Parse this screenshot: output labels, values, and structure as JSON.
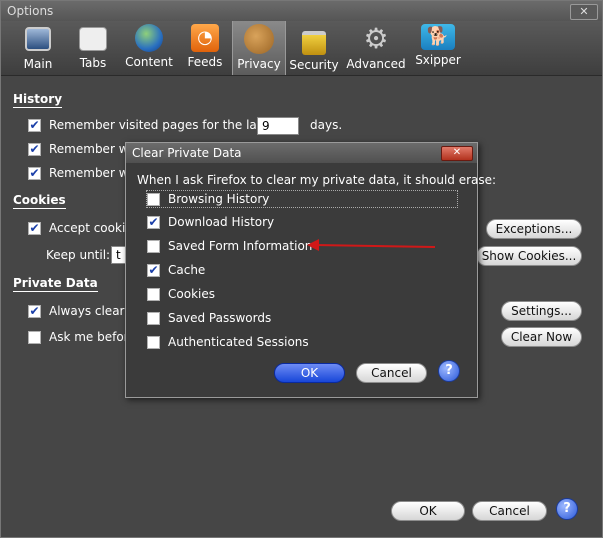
{
  "window": {
    "title": "Options",
    "close": "✕"
  },
  "tabs": [
    {
      "label": "Main",
      "icon": "monitor-icon"
    },
    {
      "label": "Tabs",
      "icon": "tabs-icon"
    },
    {
      "label": "Content",
      "icon": "globe-icon"
    },
    {
      "label": "Feeds",
      "icon": "rss-icon"
    },
    {
      "label": "Privacy",
      "icon": "cookie-icon",
      "active": true
    },
    {
      "label": "Security",
      "icon": "lock-icon"
    },
    {
      "label": "Advanced",
      "icon": "gear-icon"
    },
    {
      "label": "Sxipper",
      "icon": "dog-icon"
    }
  ],
  "history": {
    "title": "History",
    "remember_visited": "Remember visited pages for the last",
    "days_value": "9",
    "days_label": "days.",
    "remember_2": "Remember wh",
    "remember_3": "Remember wh"
  },
  "cookies": {
    "title": "Cookies",
    "accept": "Accept cookie",
    "keep_until": "Keep until:",
    "keep_value": "t",
    "exceptions": "Exceptions...",
    "show_cookies": "Show Cookies..."
  },
  "private_data": {
    "title": "Private Data",
    "always_clear": "Always clear n",
    "ask_before": "Ask me before",
    "settings": "Settings...",
    "clear_now": "Clear Now"
  },
  "footer": {
    "ok": "OK",
    "cancel": "Cancel",
    "help": "?"
  },
  "dialog": {
    "title": "Clear Private Data",
    "close": "✕",
    "prompt": "When I ask Firefox to clear my private data, it should erase:",
    "items": [
      {
        "label": "Browsing History",
        "checked": false
      },
      {
        "label": "Download History",
        "checked": true
      },
      {
        "label": "Saved Form Information",
        "checked": false
      },
      {
        "label": "Cache",
        "checked": true
      },
      {
        "label": "Cookies",
        "checked": false
      },
      {
        "label": "Saved Passwords",
        "checked": false
      },
      {
        "label": "Authenticated Sessions",
        "checked": false
      }
    ],
    "ok": "OK",
    "cancel": "Cancel",
    "help": "?"
  },
  "colors": {
    "arrow": "#d01818",
    "accent": "#1846d8"
  }
}
